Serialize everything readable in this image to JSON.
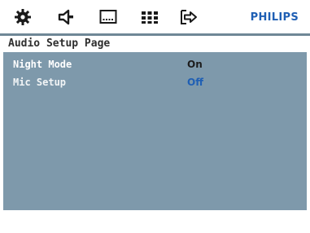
{
  "toolbar": {
    "icons": [
      "settings-gear-icon",
      "speaker-icon",
      "screen-icon",
      "preferences-grid-icon",
      "exit-arrow-icon"
    ],
    "brand": "PHILIPS"
  },
  "page": {
    "title": "Audio Setup Page"
  },
  "settings": [
    {
      "label": "Night Mode",
      "value": "On"
    },
    {
      "label": "Mic Setup",
      "value": "Off"
    }
  ],
  "colors": {
    "brand": "#1f5fb4",
    "panel": "#7e99ab",
    "highlight_value": "#1f5fb4"
  }
}
